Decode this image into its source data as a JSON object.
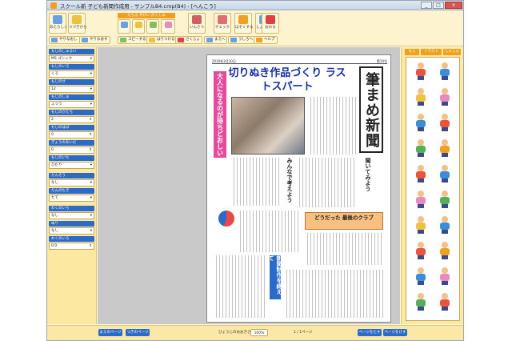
{
  "window": {
    "title": "スクール新 子ども新聞作成用 - サンプルB4.cmp(B4) - [へんこう]",
    "min_label": "_",
    "max_label": "□",
    "close_label": "×"
  },
  "toolbar": {
    "buttons": [
      {
        "id": "new",
        "label": "あたらしく",
        "color": "#6aa0e0"
      },
      {
        "id": "open",
        "label": "ひらく",
        "color": "#f0c040"
      },
      {
        "id": "save",
        "label": "つづきから",
        "color": "#80c060"
      },
      {
        "id": "print",
        "label": "いんさつ",
        "color": "#d06060"
      },
      {
        "id": "check",
        "label": "チェック",
        "color": "#e07070"
      },
      {
        "id": "zoom",
        "label": "ほそくする",
        "color": "#f0a020"
      },
      {
        "id": "shosai",
        "label": "しょうさい",
        "color": "#6aa0e0"
      },
      {
        "id": "exit",
        "label": "おわる",
        "color": "#e04040"
      }
    ],
    "group_label": "えらぶ ずけい かくしゅ",
    "row2": [
      {
        "id": "undo",
        "label": "やりなおし"
      },
      {
        "id": "redo",
        "label": "やりなおす"
      },
      {
        "id": "copy",
        "label": "コピーする"
      },
      {
        "id": "paste",
        "label": "はりつける"
      },
      {
        "id": "delete",
        "label": "さくじょ"
      },
      {
        "id": "front",
        "label": "まえへ"
      },
      {
        "id": "back",
        "label": "うしろへ"
      },
      {
        "id": "help",
        "label": "ヘルプ"
      }
    ]
  },
  "leftpanel": {
    "sections": [
      {
        "head": "もじのしゅるい",
        "value": "MS ゴシック"
      },
      {
        "head": "もじのいろ",
        "value": "くろ"
      },
      {
        "head": "もじのせ",
        "value": "12"
      },
      {
        "head": "もじのしゅ",
        "value": "ふつう"
      },
      {
        "head": "もじのかたち",
        "value": "2"
      },
      {
        "head": "もじのはば",
        "value": "0"
      },
      {
        "head": "ぎょうのあいだ",
        "value": "0"
      },
      {
        "head": "もじのいち",
        "value": "ひだり"
      },
      {
        "head": "だんそう",
        "value": "なし"
      },
      {
        "head": "だんのむき",
        "value": "たて"
      },
      {
        "head": "わくのいろ",
        "value": "なし"
      },
      {
        "head": "ぬり",
        "value": "なし"
      },
      {
        "head": "わくのいろ",
        "value": "0.0"
      }
    ]
  },
  "rightpanel": {
    "tabs": [
      "もじ",
      "イラスト",
      "しゃしん"
    ],
    "pics": [
      {
        "body": "#e8553e"
      },
      {
        "body": "#3a8ed8"
      },
      {
        "body": "#f0c040"
      },
      {
        "body": "#e88ac0"
      },
      {
        "body": "#3a8ed8"
      },
      {
        "body": "#e8553e"
      },
      {
        "body": "#54b058"
      },
      {
        "body": "#f0a020"
      },
      {
        "body": "#e8553e"
      },
      {
        "body": "#3a8ed8"
      },
      {
        "body": "#e88ac0"
      },
      {
        "body": "#54b058"
      },
      {
        "body": "#f0c040"
      },
      {
        "body": "#3a8ed8"
      },
      {
        "body": "#e8553e"
      },
      {
        "body": "#f0a020"
      },
      {
        "body": "#3a8ed8"
      },
      {
        "body": "#e88ac0"
      },
      {
        "body": "#54b058"
      },
      {
        "body": "#e8553e"
      }
    ]
  },
  "newspaper": {
    "date_left": "2010年3月10日",
    "date_right": "第10号",
    "headline": "切りぬき作品づくり ラストスパート",
    "masthead": "筆まめ新聞",
    "pink_vertical": "大人になるのが待ちどおしい",
    "blue_vertical": "新聞制作を終えて",
    "orange_box": "どうだった 最後のクラブ",
    "subhead1": "みんなで考えよう",
    "subhead2": "聞いてみよう"
  },
  "statusbar": {
    "prev_page": "まえのページ",
    "next_page": "つぎのページ",
    "zoom_label": "ひょうじのおおきさ",
    "zoom_value": "100%",
    "page_info": "1 / 1ページ",
    "add_page": "ページをたす",
    "del_page": "ページをけす"
  }
}
